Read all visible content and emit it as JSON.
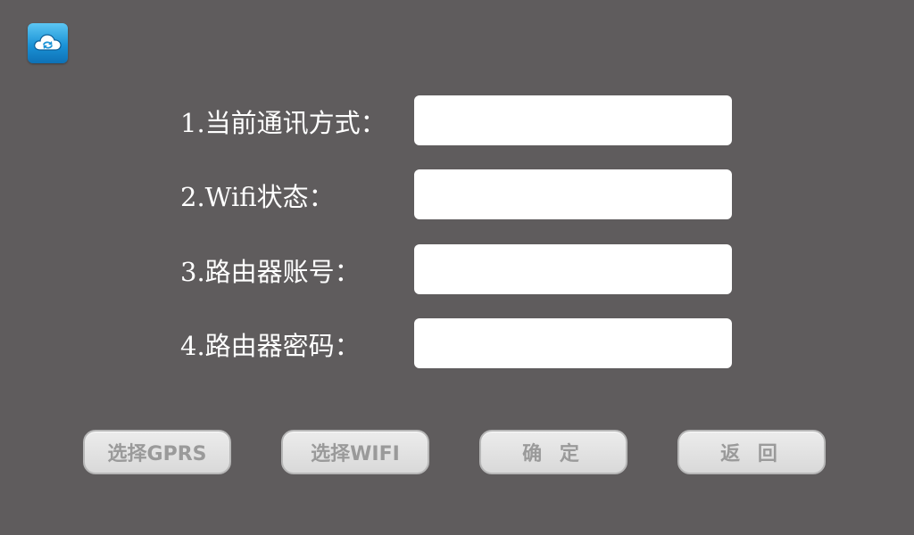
{
  "app_icon": "cloud-sync-icon",
  "form": {
    "rows": [
      {
        "label": "1.当前通讯方式：",
        "value": ""
      },
      {
        "label": "2.Wifi状态：",
        "value": ""
      },
      {
        "label": "3.路由器账号：",
        "value": ""
      },
      {
        "label": "4.路由器密码：",
        "value": ""
      }
    ]
  },
  "buttons": {
    "select_gprs": "选择GPRS",
    "select_wifi": "选择WIFI",
    "confirm": "确 定",
    "back": "返 回"
  },
  "colors": {
    "background": "#5f5c5d",
    "input_bg": "#ffffff",
    "button_bg": "#e2e2e2",
    "button_text": "#9a9a9a",
    "icon_blue": "#1a92d6"
  }
}
